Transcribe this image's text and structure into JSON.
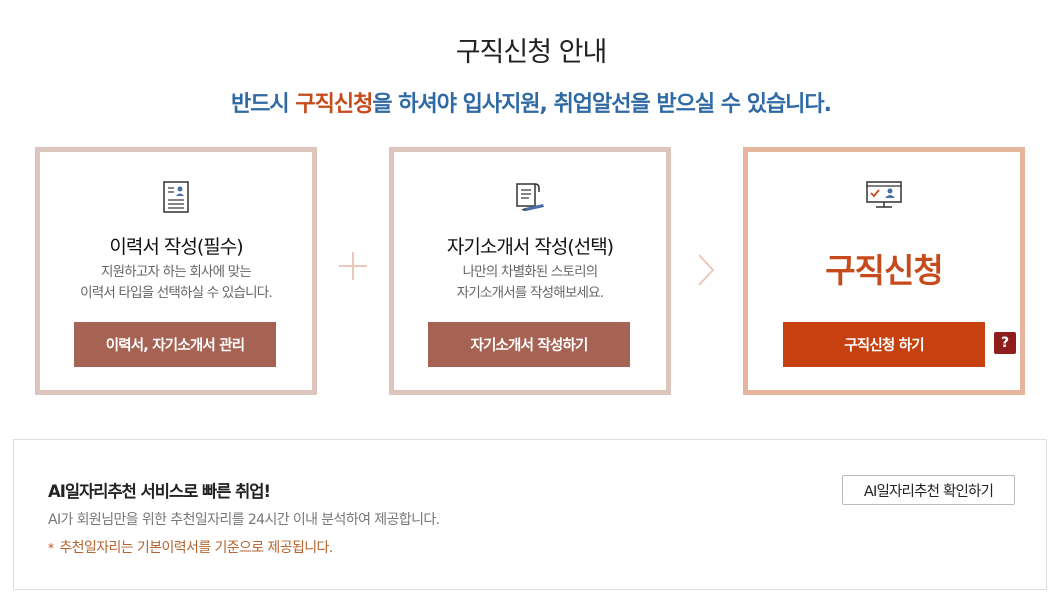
{
  "header": {
    "title": "구직신청 안내",
    "subtitle_pre": "반드시 ",
    "subtitle_hl": "구직신청",
    "subtitle_post": "을 하셔야 입사지원, 취업알선을 받으실 수 있습니다."
  },
  "steps": [
    {
      "icon": "resume-document-icon",
      "title": "이력서 작성(필수)",
      "desc_line1": "지원하고자 하는 회사에 맞는",
      "desc_line2": "이력서 타입을 선택하실 수 있습니다.",
      "button": "이력서, 자기소개서 관리"
    },
    {
      "icon": "scroll-pen-icon",
      "title": "자기소개서 작성(선택)",
      "desc_line1": "나만의 차별화된 스토리의",
      "desc_line2": "자기소개서를 작성해보세요.",
      "button": "자기소개서 작성하기"
    },
    {
      "icon": "monitor-profile-icon",
      "title": "구직신청",
      "button": "구직신청 하기",
      "help": "?"
    }
  ],
  "ai": {
    "title": "AI일자리추천 서비스로 빠른 취업!",
    "desc": "AI가 회원님만을 위한 추천일자리를 24시간 이내 분석하여 제공합니다.",
    "note_star": "*",
    "note": "추천일자리는 기본이력서를 기준으로 제공됩니다.",
    "button": "AI일자리추천 확인하기"
  },
  "colors": {
    "blue": "#2f6aa5",
    "accent": "#c64a1b",
    "button_brown": "#a66354",
    "button_orange": "#c6410f"
  }
}
